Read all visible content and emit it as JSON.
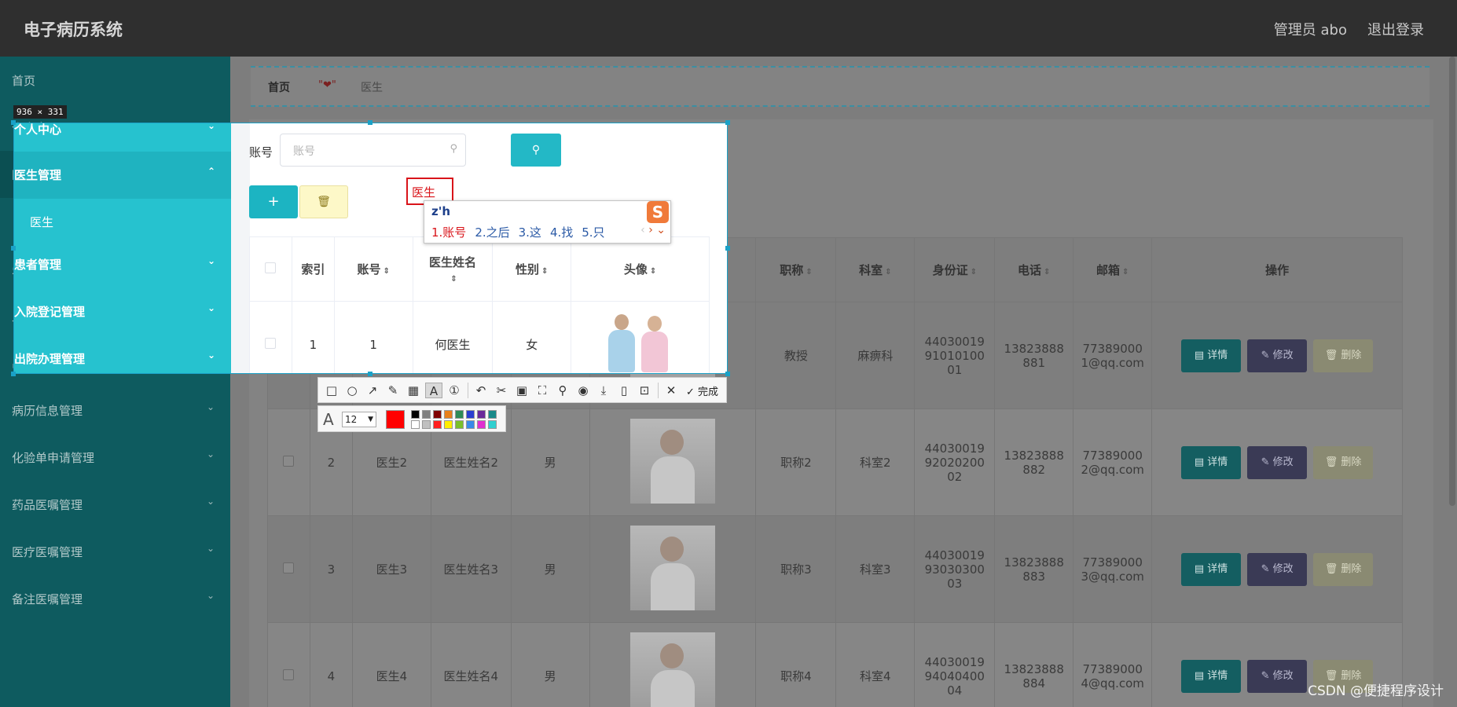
{
  "header": {
    "title": "电子病历系统",
    "user": "管理员 abo",
    "logout": "退出登录"
  },
  "sidebar": {
    "items": [
      {
        "label": "首页"
      },
      {
        "label": "个人中心"
      },
      {
        "label": "医生管理"
      },
      {
        "label": "医生"
      },
      {
        "label": "患者管理"
      },
      {
        "label": "入院登记管理"
      },
      {
        "label": "出院办理管理"
      },
      {
        "label": "病历信息管理"
      },
      {
        "label": "化验单申请管理"
      },
      {
        "label": "药品医嘱管理"
      },
      {
        "label": "医疗医嘱管理"
      },
      {
        "label": "备注医嘱管理"
      }
    ]
  },
  "breadcrumb": {
    "home": "首页",
    "separator": "\"❤\"",
    "current": "医生"
  },
  "search": {
    "label": "账号",
    "placeholder": "账号"
  },
  "annotation": {
    "text": "医生"
  },
  "selection": {
    "size_label": "936 × 331"
  },
  "ime": {
    "pinyin": "z'h",
    "candidates": [
      "1.账号",
      "2.之后",
      "3.这",
      "4.找",
      "5.只"
    ],
    "logo": "S"
  },
  "table": {
    "headers": [
      "索引",
      "账号",
      "医生姓名",
      "性别",
      "头像",
      "职称",
      "科室",
      "身份证",
      "电话",
      "邮箱",
      "操作"
    ],
    "rows": [
      {
        "index": "1",
        "account": "1",
        "name": "何医生",
        "gender": "女",
        "title": "教授",
        "dept": "麻痹科",
        "id": "44030019\n91010100\n01",
        "phone": "13823888\n881",
        "email": "77389000\n1@qq.com"
      },
      {
        "index": "2",
        "account": "医生2",
        "name": "医生姓名2",
        "gender": "男",
        "title": "职称2",
        "dept": "科室2",
        "id": "44030019\n92020200\n02",
        "phone": "13823888\n882",
        "email": "77389000\n2@qq.com"
      },
      {
        "index": "3",
        "account": "医生3",
        "name": "医生姓名3",
        "gender": "男",
        "title": "职称3",
        "dept": "科室3",
        "id": "44030019\n93030300\n03",
        "phone": "13823888\n883",
        "email": "77389000\n3@qq.com"
      },
      {
        "index": "4",
        "account": "医生4",
        "name": "医生姓名4",
        "gender": "男",
        "title": "职称4",
        "dept": "科室4",
        "id": "44030019\n94040400\n04",
        "phone": "13823888\n884",
        "email": "77389000\n4@qq.com"
      }
    ],
    "actions": {
      "detail": "详情",
      "edit": "修改",
      "delete": "删除"
    }
  },
  "toolbar": {
    "done": "完成",
    "font_size": "12"
  },
  "colors": {
    "accent": "#26c2cf",
    "sidebar": "#0e5b5f",
    "header": "#2f2f2f",
    "annotation": "#d9141a"
  },
  "watermark": "CSDN @便捷程序设计"
}
